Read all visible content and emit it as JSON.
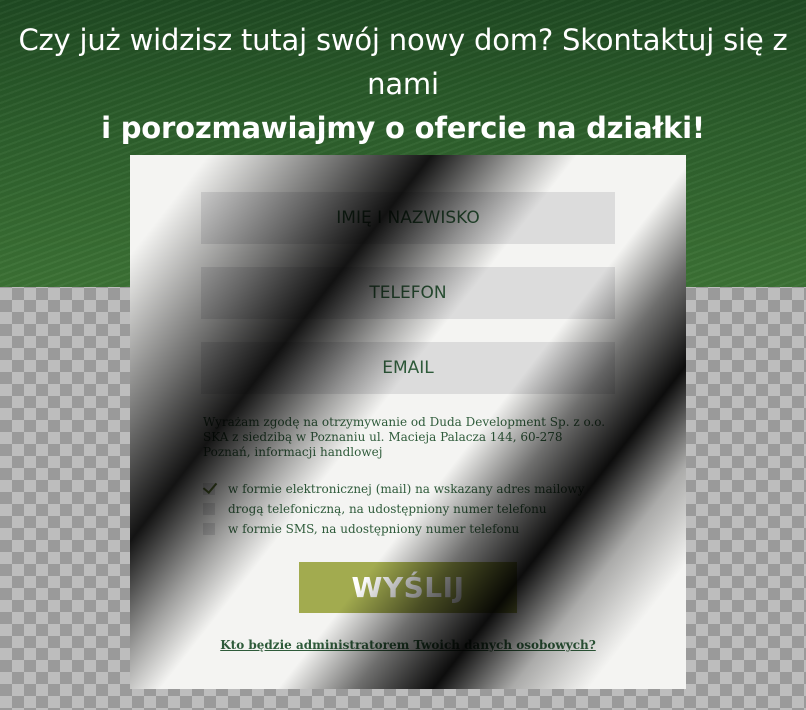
{
  "header": {
    "line1": "Czy już widzisz tutaj swój nowy dom? Skontaktuj się z nami",
    "line2": "i porozmawiajmy o ofercie na działki!"
  },
  "form": {
    "name_placeholder": "IMIĘ I NAZWISKO",
    "phone_placeholder": "TELEFON",
    "email_placeholder": "EMAIL",
    "consent_text": "Wyrażam zgodę na otrzymywanie od Duda Development Sp. z o.o. SKA z siedzibą w Poznaniu ul. Macieja Palacza 144, 60-278 Poznań, informacji handlowej",
    "options": [
      {
        "label": "w formie elektronicznej (mail) na wskazany adres mailowy",
        "checked": true
      },
      {
        "label": "drogą telefoniczną, na udostępniony numer telefonu",
        "checked": false
      },
      {
        "label": "w formie SMS, na udostępniony numer telefonu",
        "checked": false
      }
    ],
    "submit_label": "WYŚLIJ",
    "admin_link": "Kto będzie administratorem Twoich danych osobowych?"
  },
  "colors": {
    "brand_green": "#2e5b3a",
    "accent_olive": "#a2ab4f",
    "hero_green": "#2d5f2c"
  }
}
